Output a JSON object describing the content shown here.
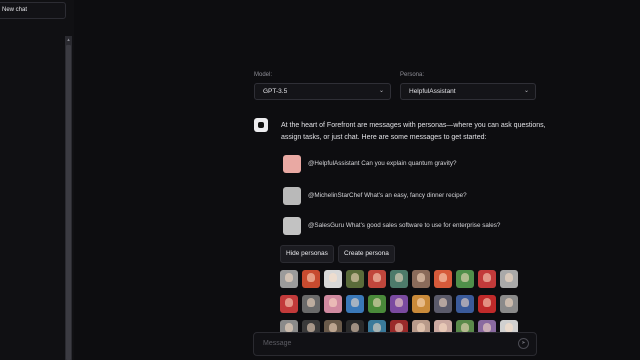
{
  "sidebar": {
    "new_chat": "New chat",
    "scroll_up_glyph": "▴"
  },
  "model": {
    "label": "Model:",
    "value": "GPT-3.5"
  },
  "persona": {
    "label": "Persona:",
    "value": "HelpfulAssistant"
  },
  "intro": "At the heart of Forefront are messages with personas—where you can ask questions, assign tasks, or just chat. Here are some messages to get started:",
  "prompts": [
    {
      "text": "@HelpfulAssistant Can you explain quantum gravity?",
      "avatar_color": "#e9a9a3"
    },
    {
      "text": "@MichelinStarChef What's an easy, fancy dinner recipe?",
      "avatar_color": "#b9b9b9"
    },
    {
      "text": "@SalesGuru What's good sales software to use for enterprise sales?",
      "avatar_color": "#c2c2c2"
    }
  ],
  "buttons": {
    "hide_personas": "Hide personas",
    "create_persona": "Create persona"
  },
  "persona_tiles": [
    [
      "#9b9b9b",
      "#c74b2f",
      "#d8d8d8",
      "#5a6b3a",
      "#c0463c",
      "#4d7a6a",
      "#8a6b5a",
      "#d65a3a",
      "#4f8f4a",
      "#c23a3a",
      "#a9a9a9"
    ],
    [
      "#c23a3a",
      "#6a6a6a",
      "#d08aa0",
      "#3a78b8",
      "#4a8a3a",
      "#7a4aa0",
      "#c98a3a",
      "#5a5a6a",
      "#3a5a9a",
      "#c02a2a",
      "#8a8a8a"
    ],
    [
      "#8a8a8a",
      "#3a3a3a",
      "#6a5a4a",
      "#2a2a2a",
      "#3a7a9a",
      "#9a2a2a",
      "#b89a8a",
      "#caa8a0",
      "#5a8a4a",
      "#8a6aa0",
      "#d0d0d0"
    ]
  ],
  "message": {
    "placeholder": "Message"
  },
  "icons": {
    "bot": "forefront-logo-icon",
    "chevron": "chevron-down-icon",
    "send": "send-icon"
  }
}
